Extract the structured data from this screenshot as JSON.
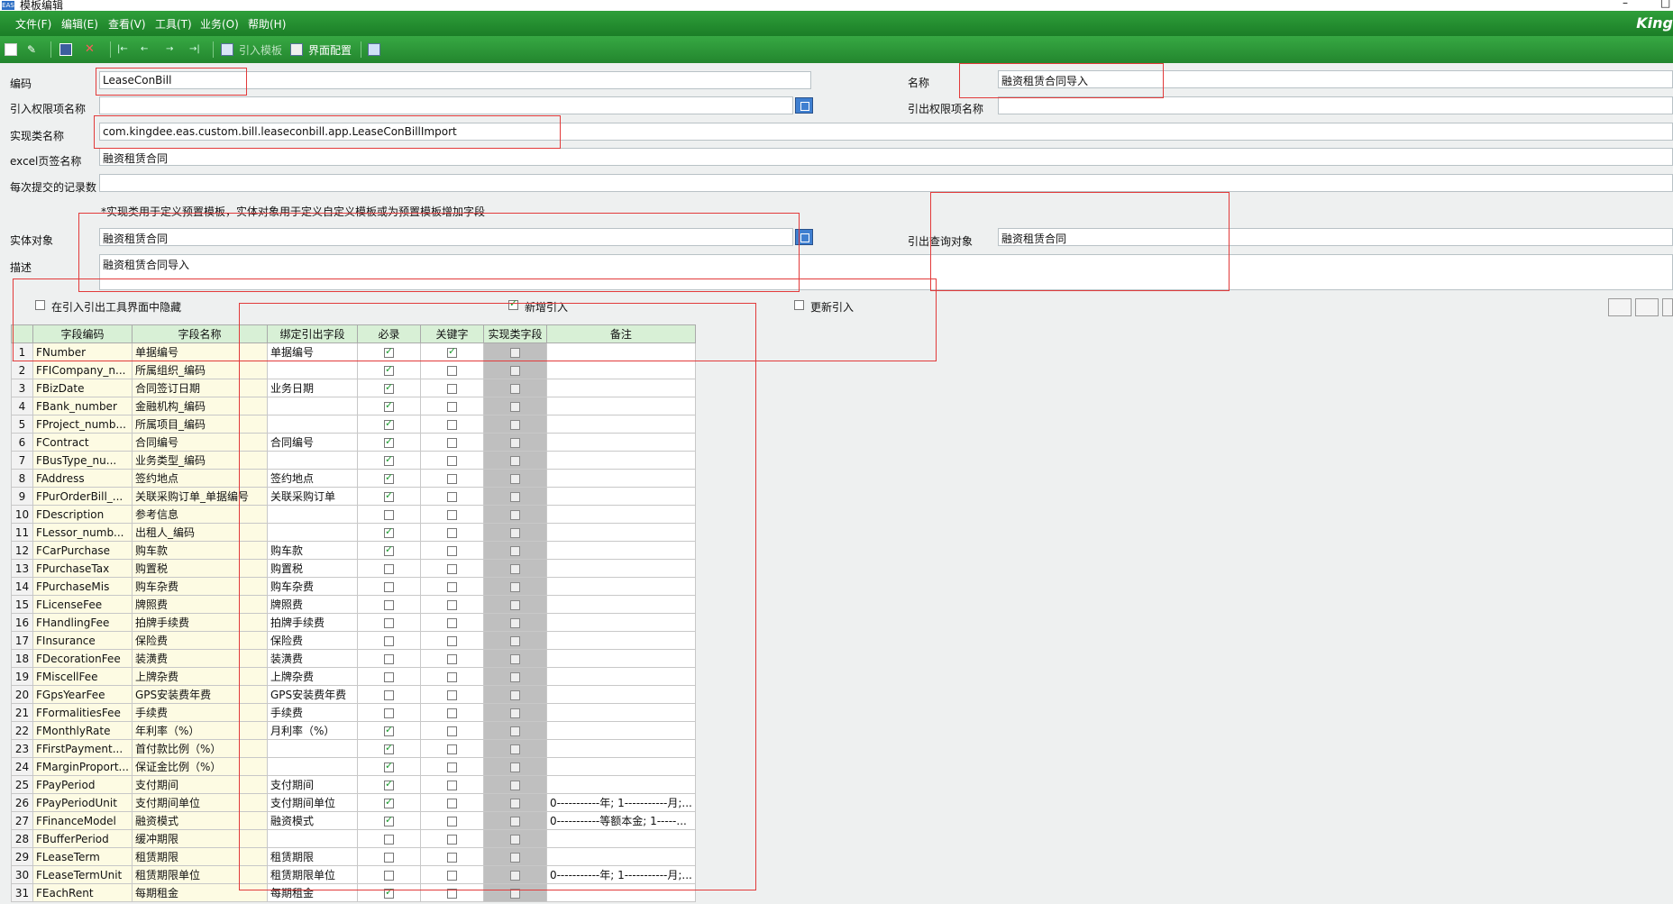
{
  "window": {
    "title": "模板编辑",
    "brand": "King"
  },
  "menu": [
    "文件(F)",
    "编辑(E)",
    "查看(V)",
    "工具(T)",
    "业务(O)",
    "帮助(H)"
  ],
  "toolbar": {
    "import_label": "引入模板",
    "ui_config_label": "界面配置"
  },
  "form": {
    "code_label": "编码",
    "code_value": "LeaseConBill",
    "name_label": "名称",
    "name_value": "融资租赁合同导入",
    "import_perm_label": "引入权限项名称",
    "import_perm_value": "",
    "export_perm_label": "引出权限项名称",
    "export_perm_value": "",
    "impl_class_label": "实现类名称",
    "impl_class_value": "com.kingdee.eas.custom.bill.leaseconbill.app.LeaseConBillImport",
    "excel_sheet_label": "excel页签名称",
    "excel_sheet_value": "融资租赁合同",
    "batch_label": "每次提交的记录数",
    "batch_value": "",
    "hint": "*实现类用于定义预置模板，实体对象用于定义自定义模板或为预置模板增加字段",
    "entity_label": "实体对象",
    "entity_value": "融资租赁合同",
    "export_query_label": "引出查询对象",
    "export_query_value": "融资租赁合同",
    "desc_label": "描述",
    "desc_value": "融资租赁合同导入",
    "hide_label": "在引入引出工具界面中隐藏",
    "hide_checked": false,
    "new_label": "新增引入",
    "new_checked": true,
    "update_label": "更新引入",
    "update_checked": false
  },
  "grid": {
    "headers": [
      "字段编码",
      "字段名称",
      "绑定引出字段",
      "必录",
      "关键字",
      "实现类字段",
      "备注"
    ],
    "rows": [
      {
        "n": "1",
        "code": "FNumber",
        "name": "单据编号",
        "bind": "单据编号",
        "req": true,
        "key": true,
        "remark": ""
      },
      {
        "n": "2",
        "code": "FFICompany_n...",
        "name": "所属组织_编码",
        "bind": "",
        "req": true,
        "key": false,
        "remark": ""
      },
      {
        "n": "3",
        "code": "FBizDate",
        "name": "合同签订日期",
        "bind": "业务日期",
        "req": true,
        "key": false,
        "remark": ""
      },
      {
        "n": "4",
        "code": "FBank_number",
        "name": "金融机构_编码",
        "bind": "",
        "req": true,
        "key": false,
        "remark": ""
      },
      {
        "n": "5",
        "code": "FProject_numb...",
        "name": "所属项目_编码",
        "bind": "",
        "req": true,
        "key": false,
        "remark": ""
      },
      {
        "n": "6",
        "code": "FContract",
        "name": "合同编号",
        "bind": "合同编号",
        "req": true,
        "key": false,
        "remark": ""
      },
      {
        "n": "7",
        "code": "FBusType_nu...",
        "name": "业务类型_编码",
        "bind": "",
        "req": true,
        "key": false,
        "remark": ""
      },
      {
        "n": "8",
        "code": "FAddress",
        "name": "签约地点",
        "bind": "签约地点",
        "req": true,
        "key": false,
        "remark": ""
      },
      {
        "n": "9",
        "code": "FPurOrderBill_...",
        "name": "关联采购订单_单据编号",
        "bind": "关联采购订单",
        "req": true,
        "key": false,
        "remark": ""
      },
      {
        "n": "10",
        "code": "FDescription",
        "name": "参考信息",
        "bind": "",
        "req": false,
        "key": false,
        "remark": ""
      },
      {
        "n": "11",
        "code": "FLessor_numb...",
        "name": "出租人_编码",
        "bind": "",
        "req": true,
        "key": false,
        "remark": ""
      },
      {
        "n": "12",
        "code": "FCarPurchase",
        "name": "购车款",
        "bind": "购车款",
        "req": true,
        "key": false,
        "remark": ""
      },
      {
        "n": "13",
        "code": "FPurchaseTax",
        "name": "购置税",
        "bind": "购置税",
        "req": false,
        "key": false,
        "remark": ""
      },
      {
        "n": "14",
        "code": "FPurchaseMis",
        "name": "购车杂费",
        "bind": "购车杂费",
        "req": false,
        "key": false,
        "remark": ""
      },
      {
        "n": "15",
        "code": "FLicenseFee",
        "name": "牌照费",
        "bind": "牌照费",
        "req": false,
        "key": false,
        "remark": ""
      },
      {
        "n": "16",
        "code": "FHandlingFee",
        "name": "拍牌手续费",
        "bind": "拍牌手续费",
        "req": false,
        "key": false,
        "remark": ""
      },
      {
        "n": "17",
        "code": "FInsurance",
        "name": "保险费",
        "bind": "保险费",
        "req": false,
        "key": false,
        "remark": ""
      },
      {
        "n": "18",
        "code": "FDecorationFee",
        "name": "装潢费",
        "bind": "装潢费",
        "req": false,
        "key": false,
        "remark": ""
      },
      {
        "n": "19",
        "code": "FMiscellFee",
        "name": "上牌杂费",
        "bind": "上牌杂费",
        "req": false,
        "key": false,
        "remark": ""
      },
      {
        "n": "20",
        "code": "FGpsYearFee",
        "name": "GPS安装费年费",
        "bind": "GPS安装费年费",
        "req": false,
        "key": false,
        "remark": ""
      },
      {
        "n": "21",
        "code": "FFormalitiesFee",
        "name": "手续费",
        "bind": "手续费",
        "req": false,
        "key": false,
        "remark": ""
      },
      {
        "n": "22",
        "code": "FMonthlyRate",
        "name": "年利率（%）",
        "bind": "月利率（%）",
        "req": true,
        "key": false,
        "remark": ""
      },
      {
        "n": "23",
        "code": "FFirstPayment...",
        "name": "首付款比例（%）",
        "bind": "",
        "req": true,
        "key": false,
        "remark": ""
      },
      {
        "n": "24",
        "code": "FMarginProport...",
        "name": "保证金比例（%）",
        "bind": "",
        "req": true,
        "key": false,
        "remark": ""
      },
      {
        "n": "25",
        "code": "FPayPeriod",
        "name": "支付期间",
        "bind": "支付期间",
        "req": true,
        "key": false,
        "remark": ""
      },
      {
        "n": "26",
        "code": "FPayPeriodUnit",
        "name": "支付期间单位",
        "bind": "支付期间单位",
        "req": true,
        "key": false,
        "remark": "0-----------年; 1-----------月;..."
      },
      {
        "n": "27",
        "code": "FFinanceModel",
        "name": "融资模式",
        "bind": "融资模式",
        "req": true,
        "key": false,
        "remark": "0-----------等额本金; 1-----..."
      },
      {
        "n": "28",
        "code": "FBufferPeriod",
        "name": "缓冲期限",
        "bind": "",
        "req": false,
        "key": false,
        "remark": ""
      },
      {
        "n": "29",
        "code": "FLeaseTerm",
        "name": "租赁期限",
        "bind": "租赁期限",
        "req": false,
        "key": false,
        "remark": ""
      },
      {
        "n": "30",
        "code": "FLeaseTermUnit",
        "name": "租赁期限单位",
        "bind": "租赁期限单位",
        "req": false,
        "key": false,
        "remark": "0-----------年; 1-----------月;..."
      },
      {
        "n": "31",
        "code": "FEachRent",
        "name": "每期租金",
        "bind": "每期租金",
        "req": true,
        "key": false,
        "remark": ""
      }
    ]
  }
}
